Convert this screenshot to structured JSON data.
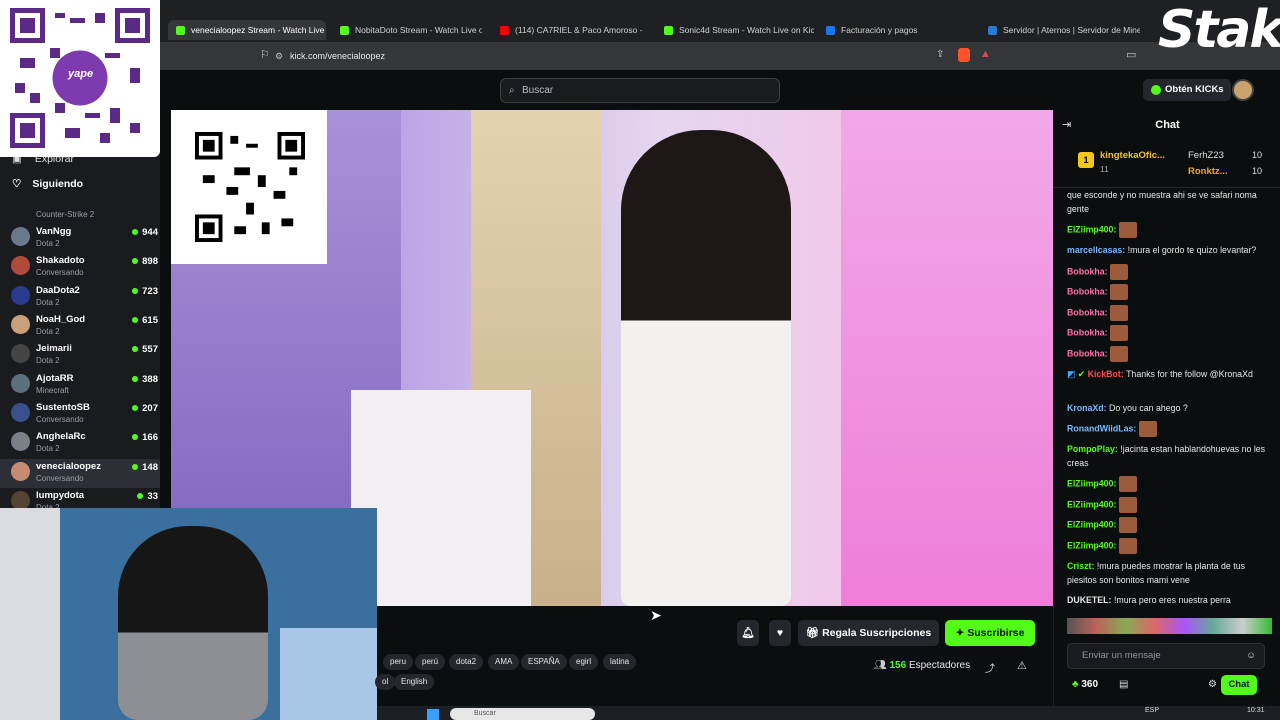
{
  "browser": {
    "tabs": [
      {
        "label": "venecialoopez Stream - Watch Live on Kick",
        "color": "#53fc18"
      },
      {
        "label": "NobitaDoto Stream - Watch Live on Kick",
        "color": "#53fc18"
      },
      {
        "label": "(114) CA7RIEL & Paco Amoroso - M",
        "color": "#ff0000"
      },
      {
        "label": "Sonic4d Stream - Watch Live on Kick",
        "color": "#53fc18"
      },
      {
        "label": "Facturación y pagos",
        "color": "#1877f2"
      },
      {
        "label": "Servidor | Aternos | Servidor de Mine",
        "color": "#2a7bd1"
      }
    ],
    "url": "kick.com/venecialoopez"
  },
  "overlay": {
    "stake_logo": "Stake",
    "yape": "yape"
  },
  "header": {
    "search_placeholder": "Buscar",
    "kicks_label": "Obtén KICKs"
  },
  "sidebar": {
    "explore": "Explorar",
    "following": "Siguiendo",
    "first_game": "Counter-Strike 2",
    "channels": [
      {
        "name": "VanNgg",
        "game": "Dota 2",
        "viewers": "944",
        "color": "#6a7a8c"
      },
      {
        "name": "Shakadoto",
        "game": "Conversando",
        "viewers": "898",
        "color": "#b04a3a"
      },
      {
        "name": "DaaDota2",
        "game": "Dota 2",
        "viewers": "723",
        "color": "#2a3b8f"
      },
      {
        "name": "NoaH_God",
        "game": "Dota 2",
        "viewers": "615",
        "color": "#c9a07a"
      },
      {
        "name": "Jeimarii",
        "game": "Dota 2",
        "viewers": "557",
        "color": "#444"
      },
      {
        "name": "AjotaRR",
        "game": "Minecraft",
        "viewers": "388",
        "color": "#5c6f7c"
      },
      {
        "name": "SustentoSB",
        "game": "Conversando",
        "viewers": "207",
        "color": "#3a4f8c"
      },
      {
        "name": "AnghelaRc",
        "game": "Dota 2",
        "viewers": "166",
        "color": "#7a7f88"
      },
      {
        "name": "venecialoopez",
        "game": "Conversando",
        "viewers": "148",
        "color": "#c78b74"
      },
      {
        "name": "lumpydota",
        "game": "Dota 2",
        "viewers": "33",
        "color": "#554433"
      }
    ]
  },
  "chat": {
    "title": "Chat",
    "pinned": [
      {
        "rank": "1",
        "name": "kingtekaOfic...",
        "count": "11"
      },
      {
        "name": "FerhZ23",
        "count": "10"
      },
      {
        "name": "Ronktz...",
        "count": "10"
      }
    ],
    "messages": [
      {
        "user": "",
        "text": "que esconde y no muestra ahi se ve safari noma gente",
        "color": "#e6e6e6"
      },
      {
        "user": "ElZiimp400:",
        "text": "",
        "emote": true,
        "color": "#53fc18"
      },
      {
        "user": "marcellcasas:",
        "text": "!mura el gordo te quizo levantar?",
        "color": "#7ab8ff"
      },
      {
        "user": "Bobokha:",
        "text": "",
        "emote": true,
        "color": "#ff6fa8"
      },
      {
        "user": "Bobokha:",
        "text": "",
        "emote": true,
        "color": "#ff6fa8"
      },
      {
        "user": "Bobokha:",
        "text": "",
        "emote": true,
        "color": "#ff6fa8"
      },
      {
        "user": "Bobokha:",
        "text": "",
        "emote": true,
        "color": "#ff6fa8"
      },
      {
        "user": "Bobokha:",
        "text": "",
        "emote": true,
        "color": "#ff6fa8"
      },
      {
        "user": "KickBot:",
        "text": "Thanks for the follow @KronaXd",
        "color": "#ff4d4d"
      },
      {
        "user": "KronaXd:",
        "text": "Do you can ahego ?",
        "color": "#7ab8ff"
      },
      {
        "user": "RonandWiidLas:",
        "text": "",
        "emote": true,
        "color": "#7ab8ff"
      },
      {
        "user": "PompoPlay:",
        "text": "!jacinta estan hablandohuevas no les creas",
        "color": "#53fc18"
      },
      {
        "user": "ElZiimp400:",
        "text": "",
        "emote": true,
        "color": "#53fc18"
      },
      {
        "user": "ElZiimp400:",
        "text": "",
        "emote": true,
        "color": "#53fc18"
      },
      {
        "user": "ElZiimp400:",
        "text": "",
        "emote": true,
        "color": "#53fc18"
      },
      {
        "user": "ElZiimp400:",
        "text": "",
        "emote": true,
        "color": "#53fc18"
      },
      {
        "user": "Criszt:",
        "text": "!mura puedes mostrar la planta de tus piesitos son bonitos mami vene",
        "color": "#53fc18"
      },
      {
        "user": "DUKETEL:",
        "text": "!mura pero eres nuestra perra",
        "color": "#e6e6e6"
      }
    ],
    "input_placeholder": "Enviar un mensaje",
    "points": "360",
    "send_label": "Chat"
  },
  "stream": {
    "gift_label": "Regala Suscripciones",
    "subscribe_label": "Suscribirse",
    "viewers": "156",
    "viewers_label": "Espectadores",
    "tags": [
      "peru",
      "perú",
      "dota2",
      "AMA",
      "ESPAÑA",
      "egirl",
      "latina"
    ],
    "tags2": [
      "ol",
      "English"
    ]
  },
  "taskbar": {
    "search": "Buscar",
    "lang": "ESP",
    "time": "10:31"
  }
}
